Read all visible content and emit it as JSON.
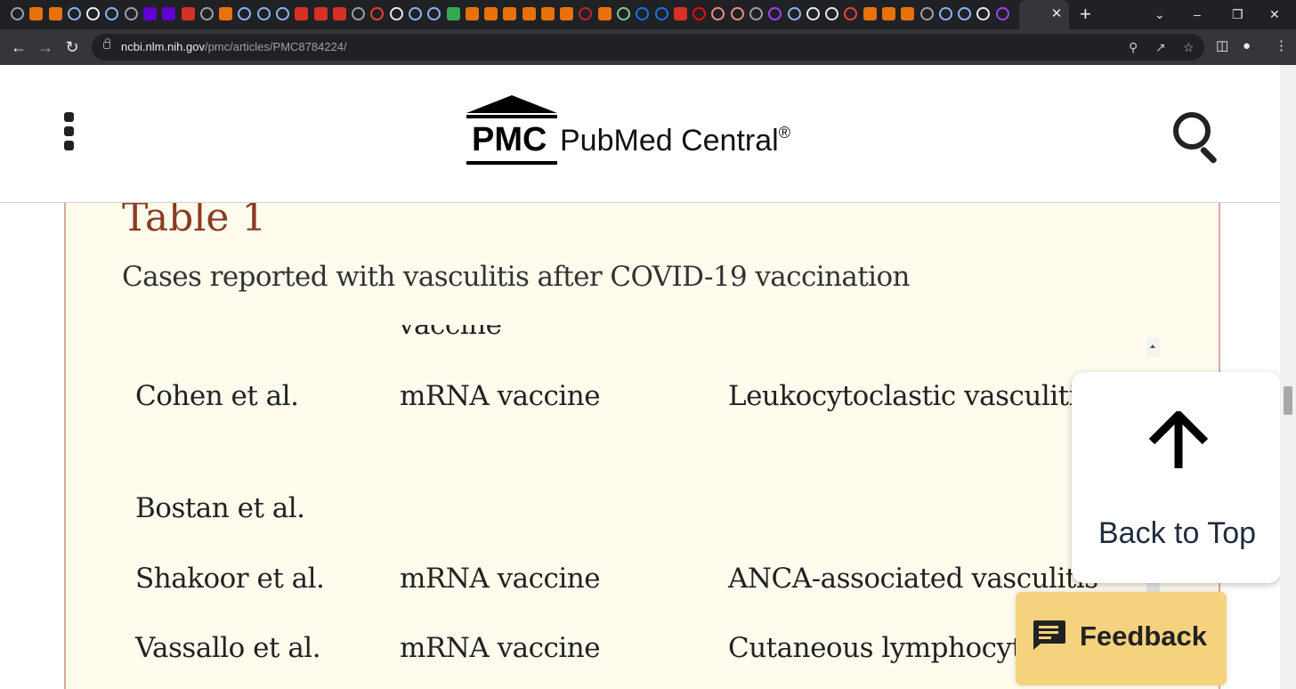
{
  "browser": {
    "url_host": "ncbi.nlm.nih.gov",
    "url_path": "/pmc/articles/PMC8784224/",
    "tab_favicons": [
      "chrome-icon",
      "bookmark-icon",
      "bookmark-icon",
      "play-icon",
      "grid-icon",
      "play-icon",
      "chrome-icon",
      "yahoo-icon",
      "yahoo-icon",
      "bi-icon",
      "li-icon",
      "bookmark-icon",
      "play-icon",
      "play-icon",
      "play-icon",
      "bi-icon",
      "bi-icon",
      "bi-icon",
      "chrome-icon",
      "star-icon",
      "ap-icon",
      "search-icon",
      "search-icon",
      "g-icon",
      "bookmark-icon",
      "bookmark-icon",
      "bookmark-icon",
      "bookmark-icon",
      "bookmark-icon",
      "bookmark-icon",
      "flag-icon",
      "bookmark-icon",
      "globe-icon",
      "hex-icon",
      "hex-icon",
      "bi-icon",
      "youtube-icon",
      "shield-icon",
      "shield-icon",
      "li-icon",
      "game-icon",
      "search-icon",
      "crest-icon",
      "gift-icon",
      "mic-icon",
      "bookmark-icon",
      "bookmark-icon",
      "bookmark-icon",
      "avatar-icon",
      "play-icon",
      "search-icon",
      "news-icon",
      "tv-icon"
    ],
    "favicon_colors": {
      "chrome-icon": "#9aa0a6",
      "bookmark-icon": "#e8710a",
      "play-icon": "#8ab4f8",
      "grid-icon": "#f1f3f4",
      "yahoo-icon": "#6001d2",
      "bi-icon": "#d93025",
      "li-icon": "#9aa0a6",
      "star-icon": "#ea4335",
      "ap-icon": "#e8eaed",
      "search-icon": "#8ab4f8",
      "g-icon": "#34a853",
      "flag-icon": "#c5221f",
      "globe-icon": "#81c995",
      "hex-icon": "#1a73e8",
      "youtube-icon": "#ff0000",
      "shield-icon": "#f28b82",
      "game-icon": "#a142f4",
      "crest-icon": "#e8eaed",
      "gift-icon": "#e8eaed",
      "mic-icon": "#ea4335",
      "avatar-icon": "#9aa0a6",
      "news-icon": "#e8eaed",
      "tv-icon": "#a142f4"
    },
    "close_glyph": "✕",
    "newtab_glyph": "+"
  },
  "header": {
    "logo_abbr": "PMC",
    "logo_name": "PubMed Central",
    "logo_mark": "®"
  },
  "article": {
    "table_label": "Table 1",
    "caption": "Cases reported with vasculitis after COVID-19 vaccination",
    "partial_header_fragment": "vaccine",
    "rows": [
      {
        "author": "Cohen et al.",
        "vaccine": "mRNA vaccine",
        "type": "Leukocytoclastic vasculitis"
      },
      {
        "author": "Bostan et al.",
        "vaccine": "",
        "type": ""
      },
      {
        "author": "Shakoor et al.",
        "vaccine": "mRNA vaccine",
        "type": "ANCA-associated vasculitis"
      },
      {
        "author": "Vassallo et al.",
        "vaccine": "mRNA vaccine",
        "type": "Cutaneous lymphocytic vasculitis"
      }
    ]
  },
  "back_to_top": {
    "label": "Back to Top"
  },
  "feedback": {
    "label": "Feedback",
    "color": "#f5d37e"
  }
}
